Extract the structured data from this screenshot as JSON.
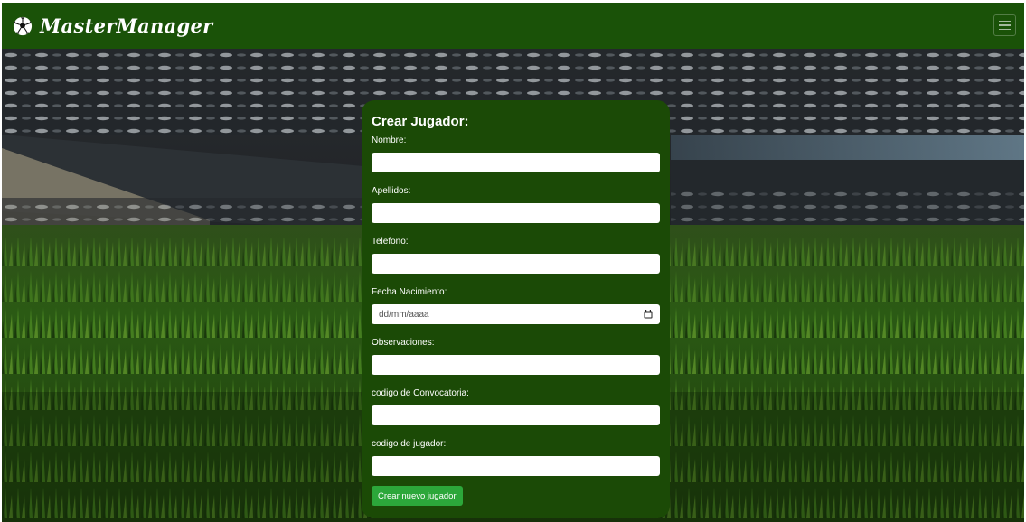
{
  "navbar": {
    "brand": "MasterManager",
    "brand_icon": "soccer-ball-icon",
    "menu_icon": "hamburger-menu-icon",
    "bg_color": "#1a5208"
  },
  "form": {
    "title": "Crear Jugador:",
    "fields": [
      {
        "label": "Nombre:",
        "value": "",
        "placeholder": ""
      },
      {
        "label": "Apellidos:",
        "value": "",
        "placeholder": ""
      },
      {
        "label": "Telefono:",
        "value": "",
        "placeholder": ""
      },
      {
        "label": "Fecha Nacimiento:",
        "value": "",
        "placeholder": "dd/mm/aaaa"
      },
      {
        "label": "Observaciones:",
        "value": "",
        "placeholder": ""
      },
      {
        "label": "codigo de Convocatoria:",
        "value": "",
        "placeholder": ""
      },
      {
        "label": "codigo de jugador:",
        "value": "",
        "placeholder": ""
      }
    ],
    "submit_label": "Crear nuevo jugador",
    "card_color": "#1b4a06",
    "button_color": "#2ca73a"
  }
}
